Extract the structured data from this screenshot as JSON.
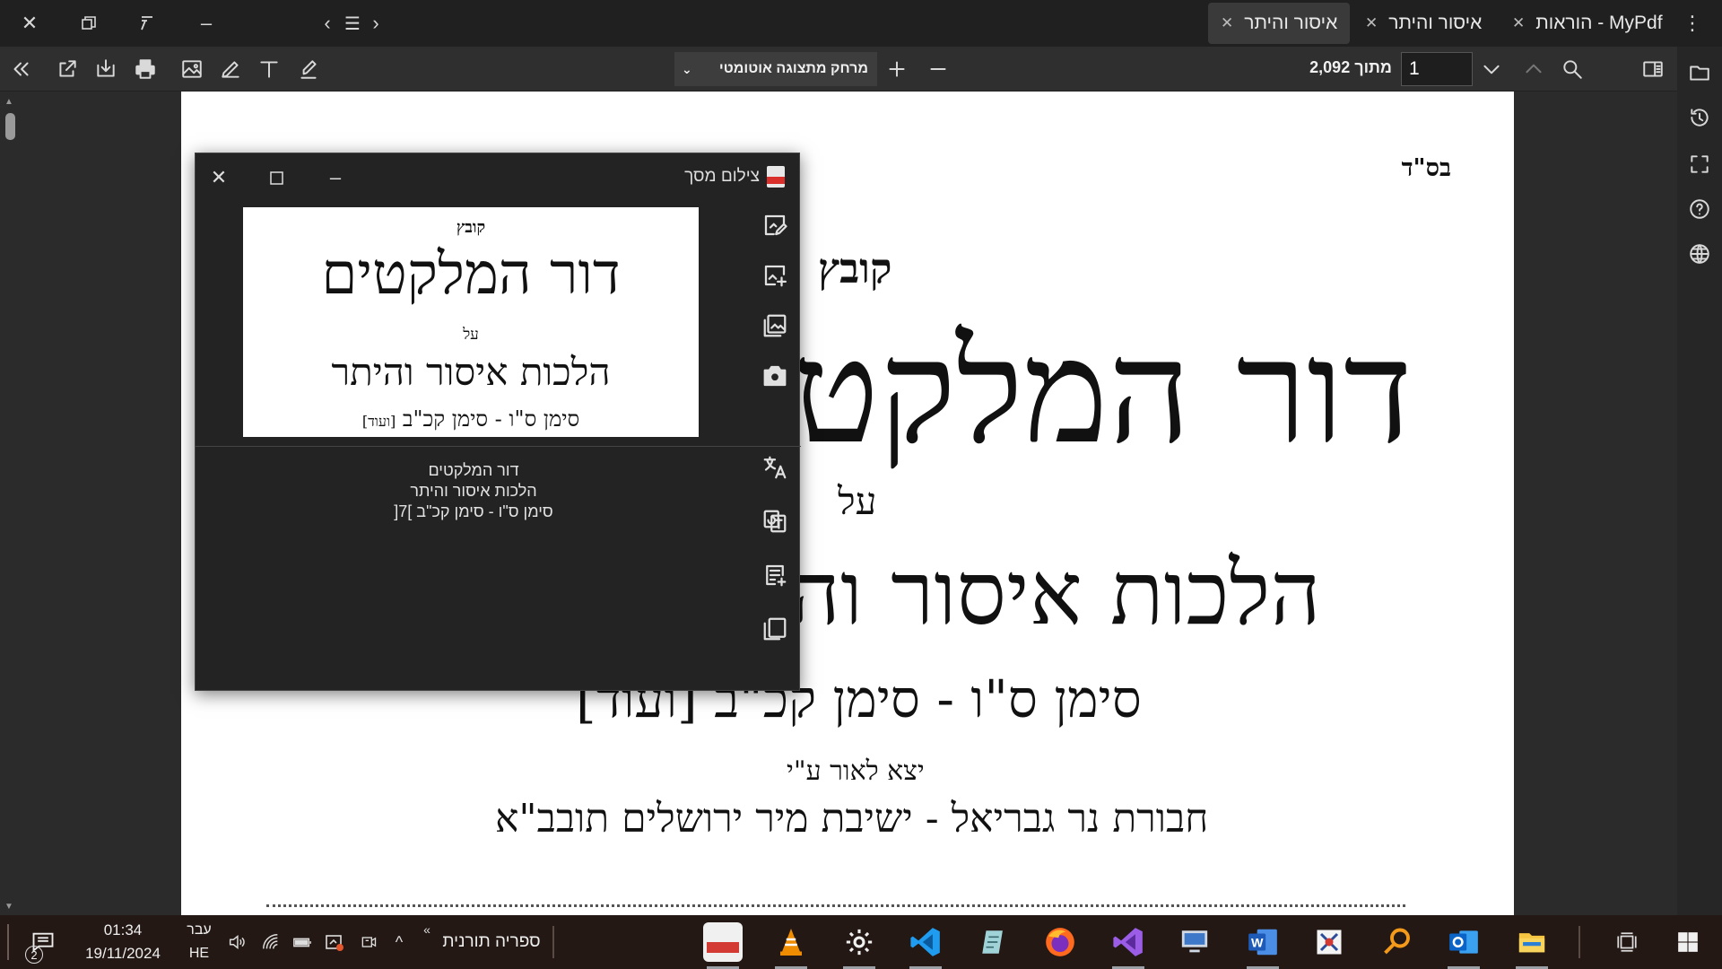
{
  "window": {
    "tabs": [
      {
        "label": "הוראות - MyPdf",
        "active": false
      },
      {
        "label": "איסור והיתר",
        "active": false
      },
      {
        "label": "איסור והיתר",
        "active": true
      }
    ],
    "left_controls": [
      "close-icon",
      "restore-icon",
      "pin-icon",
      "minimize-icon",
      "chevron-left-icon",
      "menu-icon",
      "chevron-right-icon"
    ],
    "menu_icon": "kebab-icon"
  },
  "toolbar": {
    "zoom_label": "מרחק מתצוגה אוטומטי",
    "page_value": "1",
    "page_count": "מתוך 2,092",
    "tools": [
      "double-chevron-left-icon",
      "export-icon",
      "import-icon",
      "print-icon",
      "image-icon",
      "pen-icon",
      "text-icon",
      "highlighter-icon"
    ]
  },
  "sidebar": {
    "icons": [
      "folder-icon",
      "history-icon",
      "fullscreen-icon",
      "help-icon",
      "globe-icon"
    ]
  },
  "document": {
    "header_mark": "בס\"ד",
    "kovetz": "קובץ",
    "title": "דור המלקטים",
    "al": "על",
    "subtitle": "הלכות איסור והיתר",
    "range": "סימן ס\"ו - סימן קכ\"ב [ועוד]",
    "published": "יצא לאור ע\"י",
    "publisher": "חבורת נר גבריאל - ישיבת מיר ירושלים תובב\"א"
  },
  "snip": {
    "title": "צילום מסך",
    "image": {
      "kovetz": "קובץ",
      "title": "דור המלקטים",
      "al": "על",
      "subtitle": "הלכות איסור והיתר",
      "range": "סימן ס\"ו - סימן קכ\"ב",
      "extra": "[ועוד]"
    },
    "ocr_lines": [
      "דור המלקטים",
      "הלכות איסור והיתר",
      "סימן ס\"ו - סימן קכ\"ב ]7["
    ],
    "tools": [
      "edit-image-icon",
      "add-image-icon",
      "gallery-icon",
      "camera-icon",
      "translate-icon",
      "google-translate-icon",
      "add-note-icon",
      "copy-icon"
    ]
  },
  "taskbar": {
    "notif_count": "2",
    "time": "01:34",
    "date": "19/11/2024",
    "lang_top": "עבר",
    "lang_bottom": "HE",
    "toolbar_label": "ספריה תורנית",
    "apps": [
      "pdf-app-icon",
      "vlc-icon",
      "settings-icon",
      "vscode-icon",
      "notepad-icon",
      "firefox-icon",
      "visual-studio-icon",
      "remote-desktop-icon",
      "word-icon",
      "tool-icon",
      "search-app-icon",
      "outlook-icon",
      "file-explorer-icon"
    ]
  }
}
